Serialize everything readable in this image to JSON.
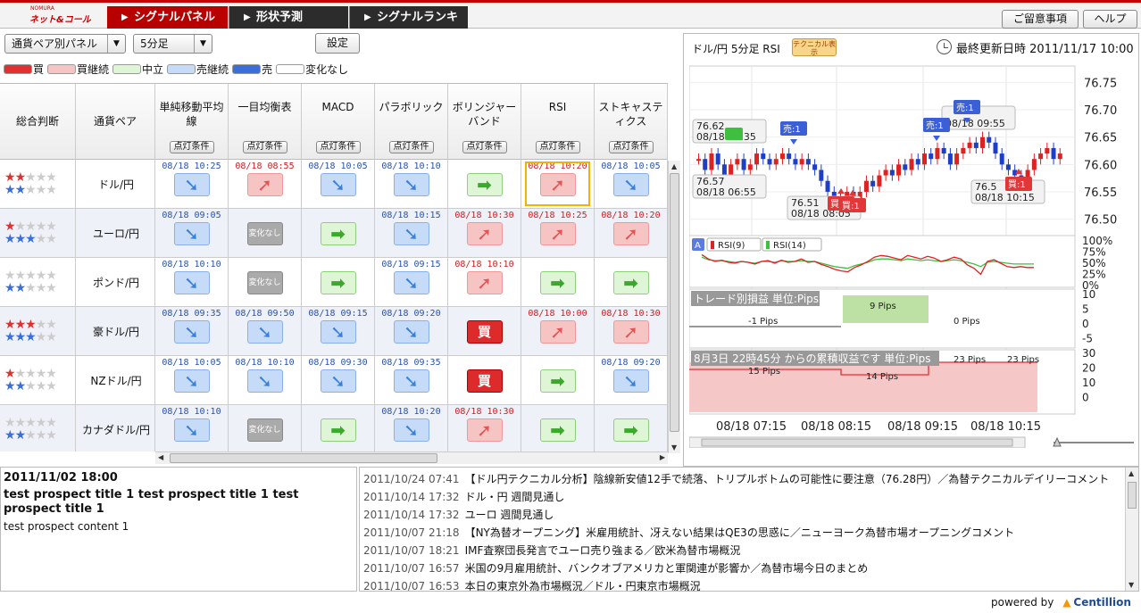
{
  "logo": {
    "small": "NOMURA",
    "big": "ネット&コール"
  },
  "nav": {
    "signal_panel": "シグナルパネル",
    "shape_forecast": "形状予測",
    "signal_ranking": "シグナルランキング",
    "notice": "ご留意事項",
    "help": "ヘルプ"
  },
  "controls": {
    "pair_select": "通貨ペア別パネル",
    "timeframe_select": "5分足",
    "setting_label": "設定"
  },
  "legend": [
    {
      "label": "買",
      "color": "#e03030"
    },
    {
      "label": "買継続",
      "color": "#f7c4c4"
    },
    {
      "label": "中立",
      "color": "#dff6d6"
    },
    {
      "label": "売継続",
      "color": "#c6dbf8"
    },
    {
      "label": "売",
      "color": "#3a6ed8"
    },
    {
      "label": "変化なし",
      "color": "#ffffff"
    }
  ],
  "grid": {
    "cond_label": "点灯条件",
    "columns": [
      "総合判断",
      "通貨ペア",
      "単純移動平均線",
      "一目均衡表",
      "MACD",
      "パラボリック",
      "ボリンジャーバンド",
      "RSI",
      "ストキャスティクス"
    ],
    "nochange_text": "変化なし",
    "buy_text": "買",
    "rows": [
      {
        "pair": "ドル/円",
        "red_stars": 2,
        "blue_stars": 2,
        "signals": [
          {
            "ts": "08/18 10:25",
            "tc": "blue",
            "type": "sell"
          },
          {
            "ts": "08/18 08:55",
            "tc": "red",
            "type": "buycont"
          },
          {
            "ts": "08/18 10:05",
            "tc": "blue",
            "type": "sell"
          },
          {
            "ts": "08/18 10:10",
            "tc": "blue",
            "type": "sell"
          },
          {
            "ts": "",
            "tc": "blue",
            "type": "neutral"
          },
          {
            "ts": "08/18 10:20",
            "tc": "red",
            "type": "buycont",
            "selected": true
          },
          {
            "ts": "08/18 10:05",
            "tc": "blue",
            "type": "sell"
          }
        ]
      },
      {
        "pair": "ユーロ/円",
        "red_stars": 1,
        "blue_stars": 3,
        "signals": [
          {
            "ts": "08/18 09:05",
            "tc": "blue",
            "type": "sell"
          },
          {
            "ts": "",
            "tc": "blue",
            "type": "nochange"
          },
          {
            "ts": "",
            "tc": "blue",
            "type": "neutral"
          },
          {
            "ts": "08/18 10:15",
            "tc": "blue",
            "type": "sell"
          },
          {
            "ts": "08/18 10:30",
            "tc": "red",
            "type": "buycont"
          },
          {
            "ts": "08/18 10:25",
            "tc": "red",
            "type": "buycont"
          },
          {
            "ts": "08/18 10:20",
            "tc": "red",
            "type": "buycont"
          }
        ]
      },
      {
        "pair": "ポンド/円",
        "red_stars": 0,
        "blue_stars": 2,
        "signals": [
          {
            "ts": "08/18 10:10",
            "tc": "blue",
            "type": "sell"
          },
          {
            "ts": "",
            "tc": "blue",
            "type": "nochange"
          },
          {
            "ts": "",
            "tc": "blue",
            "type": "neutral"
          },
          {
            "ts": "08/18 09:15",
            "tc": "blue",
            "type": "sell"
          },
          {
            "ts": "08/18 10:10",
            "tc": "red",
            "type": "buycont"
          },
          {
            "ts": "",
            "tc": "blue",
            "type": "neutral"
          },
          {
            "ts": "",
            "tc": "blue",
            "type": "neutral"
          }
        ]
      },
      {
        "pair": "豪ドル/円",
        "red_stars": 3,
        "blue_stars": 3,
        "signals": [
          {
            "ts": "08/18 09:35",
            "tc": "blue",
            "type": "sell"
          },
          {
            "ts": "08/18 09:50",
            "tc": "blue",
            "type": "sell"
          },
          {
            "ts": "08/18 09:15",
            "tc": "blue",
            "type": "sell"
          },
          {
            "ts": "08/18 09:20",
            "tc": "blue",
            "type": "sell"
          },
          {
            "ts": "",
            "tc": "blue",
            "type": "buy"
          },
          {
            "ts": "08/18 10:00",
            "tc": "red",
            "type": "buycont"
          },
          {
            "ts": "08/18 10:30",
            "tc": "red",
            "type": "buycont"
          }
        ]
      },
      {
        "pair": "NZドル/円",
        "red_stars": 1,
        "blue_stars": 2,
        "signals": [
          {
            "ts": "08/18 10:05",
            "tc": "blue",
            "type": "sell"
          },
          {
            "ts": "08/18 10:10",
            "tc": "blue",
            "type": "sell"
          },
          {
            "ts": "08/18 09:30",
            "tc": "blue",
            "type": "sell"
          },
          {
            "ts": "08/18 09:35",
            "tc": "blue",
            "type": "sell"
          },
          {
            "ts": "",
            "tc": "blue",
            "type": "buy"
          },
          {
            "ts": "",
            "tc": "blue",
            "type": "neutral"
          },
          {
            "ts": "08/18 09:20",
            "tc": "blue",
            "type": "sell"
          }
        ]
      },
      {
        "pair": "カナダドル/円",
        "red_stars": 0,
        "blue_stars": 2,
        "signals": [
          {
            "ts": "08/18 10:10",
            "tc": "blue",
            "type": "sell"
          },
          {
            "ts": "",
            "tc": "blue",
            "type": "nochange"
          },
          {
            "ts": "",
            "tc": "blue",
            "type": "neutral"
          },
          {
            "ts": "08/18 10:20",
            "tc": "blue",
            "type": "sell"
          },
          {
            "ts": "08/18 10:30",
            "tc": "red",
            "type": "buycont"
          },
          {
            "ts": "",
            "tc": "blue",
            "type": "neutral"
          },
          {
            "ts": "",
            "tc": "blue",
            "type": "neutral"
          }
        ]
      }
    ]
  },
  "chart_panel": {
    "title": "ドル/円 5分足 RSI",
    "badge": "テクニカル表示",
    "updated_label": "最終更新日時",
    "updated_value": "2011/11/17 10:00"
  },
  "chart_data": {
    "type": "line",
    "price_ticks": [
      "76.75",
      "76.70",
      "76.65",
      "76.60",
      "76.55",
      "76.50"
    ],
    "ylim": [
      76.47,
      76.78
    ],
    "closes": [
      76.61,
      76.59,
      76.62,
      76.6,
      76.58,
      76.6,
      76.61,
      76.59,
      76.6,
      76.62,
      76.61,
      76.6,
      76.61,
      76.62,
      76.61,
      76.6,
      76.61,
      76.6,
      76.59,
      76.57,
      76.55,
      76.54,
      76.52,
      76.55,
      76.53,
      76.55,
      76.57,
      76.56,
      76.58,
      76.59,
      76.58,
      76.6,
      76.59,
      76.61,
      76.6,
      76.62,
      76.61,
      76.63,
      76.62,
      76.6,
      76.62,
      76.63,
      76.64,
      76.63,
      76.65,
      76.64,
      76.62,
      76.6,
      76.59,
      76.58,
      76.55,
      76.59,
      76.61,
      76.62,
      76.63,
      76.61,
      76.62
    ],
    "annotations": [
      {
        "text": "76.62",
        "sub": "08/18 09:35"
      },
      {
        "text": "76.57",
        "sub": "08/18 06:55"
      },
      {
        "text": "76.51",
        "sub": "08/18 08:05"
      },
      {
        "text": "76.5",
        "sub": "08/18 10:15"
      },
      {
        "text": "",
        "sub": "08/18 09:55"
      }
    ],
    "markers": {
      "sell": "売:1",
      "buy": "買:1"
    },
    "rsi": {
      "legend": [
        "RSI(9)",
        "RSI(14)"
      ],
      "ticks": [
        "100%",
        "75%",
        "50%",
        "25%",
        "0%"
      ],
      "rsi9": [
        68,
        58,
        52,
        55,
        50,
        48,
        52,
        50,
        46,
        52,
        54,
        48,
        55,
        50,
        52,
        58,
        50,
        52,
        45,
        40,
        34,
        30,
        28,
        38,
        44,
        52,
        62,
        66,
        64,
        60,
        56,
        66,
        62,
        58,
        64,
        60,
        52,
        56,
        62,
        58,
        44,
        36,
        22,
        52,
        56,
        48,
        40,
        38,
        40,
        38,
        38
      ],
      "rsi14": [
        62,
        56,
        54,
        54,
        52,
        50,
        52,
        50,
        48,
        52,
        52,
        50,
        54,
        52,
        52,
        54,
        52,
        52,
        48,
        44,
        40,
        38,
        36,
        42,
        46,
        50,
        56,
        58,
        58,
        56,
        54,
        58,
        56,
        54,
        56,
        54,
        52,
        54,
        56,
        54,
        50,
        46,
        40,
        50,
        52,
        50,
        48,
        46,
        46,
        46,
        46
      ]
    },
    "trade": {
      "label": "トレード別損益 単位:Pips",
      "ticks": [
        "10",
        "5",
        "0",
        "-5"
      ],
      "segments": [
        {
          "value": -1,
          "text": "-1 Pips"
        },
        {
          "value": 9,
          "text": "9 Pips"
        },
        {
          "value": 0,
          "text": "0 Pips"
        }
      ]
    },
    "cumulative": {
      "label": "8月3日 22時45分 からの累積収益です 単位:Pips",
      "ticks": [
        "30",
        "20",
        "10",
        "0"
      ],
      "segments": [
        {
          "value": 15,
          "text": "15 Pips"
        },
        {
          "value": 14,
          "text": "14 Pips"
        },
        {
          "value": 23,
          "text": "23 Pips"
        },
        {
          "value": 23,
          "text": "23 Pips"
        }
      ]
    },
    "x_ticks": [
      "08/18 07:15",
      "08/18 08:15",
      "08/18 09:15",
      "08/18 10:15"
    ]
  },
  "news_left": {
    "date": "2011/11/02 18:00",
    "title": "test prospect title 1 test prospect title 1 test prospect title 1",
    "content": "test prospect  content 1"
  },
  "news_list": [
    {
      "date": "2011/10/24 07:41",
      "text": "【ドル円テクニカル分析】陰線新安値12手で続落、トリプルボトムの可能性に要注意（76.28円）／為替テクニカルデイリーコメント"
    },
    {
      "date": "2011/10/14 17:32",
      "text": "ドル・円 週間見通し"
    },
    {
      "date": "2011/10/14 17:32",
      "text": "ユーロ 週間見通し"
    },
    {
      "date": "2011/10/07 21:18",
      "text": "【NY為替オープニング】米雇用統計、冴えない結果はQE3の思惑に／ニューヨーク為替市場オープニングコメント"
    },
    {
      "date": "2011/10/07 18:21",
      "text": "IMF査察団長発言でユーロ売り強まる／欧米為替市場概況"
    },
    {
      "date": "2011/10/07 16:57",
      "text": "米国の9月雇用統計、バンクオブアメリカと軍関連が影響か／為替市場今日のまとめ"
    },
    {
      "date": "2011/10/07 16:53",
      "text": "本日の東京外為市場概況／ドル・円東京市場概況"
    }
  ],
  "footer": {
    "powered": "powered by",
    "brand": "Centillion"
  }
}
